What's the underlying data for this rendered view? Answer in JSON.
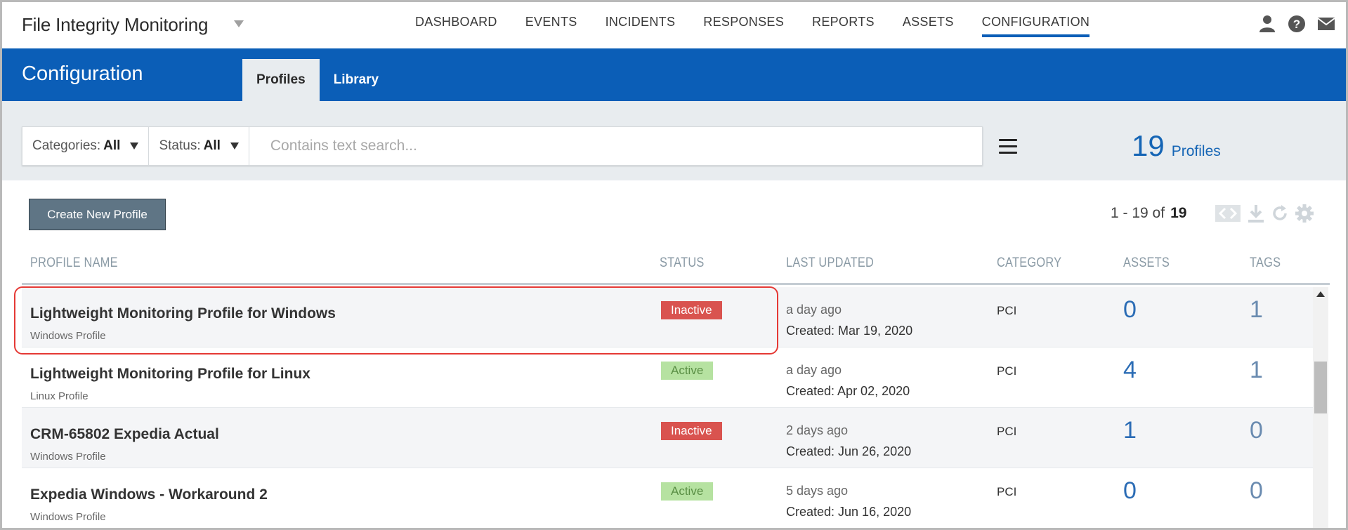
{
  "app": {
    "title": "File Integrity Monitoring"
  },
  "nav": {
    "items": [
      {
        "label": "DASHBOARD"
      },
      {
        "label": "EVENTS"
      },
      {
        "label": "INCIDENTS"
      },
      {
        "label": "RESPONSES"
      },
      {
        "label": "REPORTS"
      },
      {
        "label": "ASSETS"
      },
      {
        "label": "CONFIGURATION",
        "active": true
      }
    ],
    "icons": [
      "user-icon",
      "help-icon",
      "mail-icon"
    ]
  },
  "header": {
    "title": "Configuration",
    "tabs": [
      {
        "label": "Profiles",
        "active": true
      },
      {
        "label": "Library"
      }
    ]
  },
  "filters": {
    "categories_label": "Categories:",
    "categories_value": "All",
    "status_label": "Status:",
    "status_value": "All",
    "search_placeholder": "Contains text search..."
  },
  "summary": {
    "count": "19",
    "count_label": "Profiles"
  },
  "toolbar": {
    "create_label": "Create New Profile",
    "pager_range": "1 - 19 of",
    "pager_total": "19"
  },
  "table": {
    "columns": [
      "PROFILE NAME",
      "STATUS",
      "LAST UPDATED",
      "CATEGORY",
      "ASSETS",
      "TAGS"
    ],
    "rows": [
      {
        "name": "Lightweight Monitoring Profile for Windows",
        "sub": "Windows Profile",
        "status": "Inactive",
        "updated": "a day ago",
        "created": "Created: Mar 19, 2020",
        "category": "PCI",
        "assets": "0",
        "tags": "1"
      },
      {
        "name": "Lightweight Monitoring Profile for Linux",
        "sub": "Linux Profile",
        "status": "Active",
        "updated": "a day ago",
        "created": "Created: Apr 02, 2020",
        "category": "PCI",
        "assets": "4",
        "tags": "1"
      },
      {
        "name": "CRM-65802 Expedia Actual",
        "sub": "Windows Profile",
        "status": "Inactive",
        "updated": "2 days ago",
        "created": "Created: Jun 26, 2020",
        "category": "PCI",
        "assets": "1",
        "tags": "0"
      },
      {
        "name": "Expedia Windows - Workaround 2",
        "sub": "Windows Profile",
        "status": "Active",
        "updated": "5 days ago",
        "created": "Created: Jun 16, 2020",
        "category": "PCI",
        "assets": "0",
        "tags": "0"
      }
    ]
  },
  "colors": {
    "brand_blue": "#0b5eb7",
    "inactive": "#d9534f",
    "active": "#b6e2a1"
  }
}
